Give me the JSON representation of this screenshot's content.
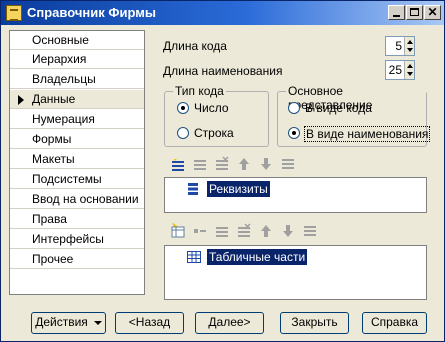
{
  "window": {
    "title": "Справочник Фирмы"
  },
  "nav": {
    "items": [
      {
        "label": "Основные"
      },
      {
        "label": "Иерархия"
      },
      {
        "label": "Владельцы"
      },
      {
        "label": "Данные"
      },
      {
        "label": "Нумерация"
      },
      {
        "label": "Формы"
      },
      {
        "label": "Макеты"
      },
      {
        "label": "Подсистемы"
      },
      {
        "label": "Ввод на основании"
      },
      {
        "label": "Права"
      },
      {
        "label": "Интерфейсы"
      },
      {
        "label": "Прочее"
      }
    ],
    "selected": "Данные"
  },
  "fields": {
    "code_length_label": "Длина кода",
    "code_length_value": "5",
    "name_length_label": "Длина наименования",
    "name_length_value": "25"
  },
  "code_type": {
    "title": "Тип кода",
    "options": [
      "Число",
      "Строка"
    ],
    "selected": "Число"
  },
  "main_presentation": {
    "title": "Основное представление",
    "options": [
      "В виде кода",
      "В виде наименования"
    ],
    "selected": "В виде наименования"
  },
  "attributes": {
    "label": "Реквизиты"
  },
  "tabular_parts": {
    "label": "Табличные части"
  },
  "buttons": {
    "actions": "Действия",
    "back": "<Назад",
    "next": "Далее>",
    "close": "Закрыть",
    "help": "Справка"
  },
  "icons": {
    "app": "catalog-icon",
    "minimize": "minimize-icon",
    "maximize": "maximize-icon",
    "close": "close-icon",
    "attributes": "attributes-list-icon",
    "tabular_parts": "table-icon"
  }
}
